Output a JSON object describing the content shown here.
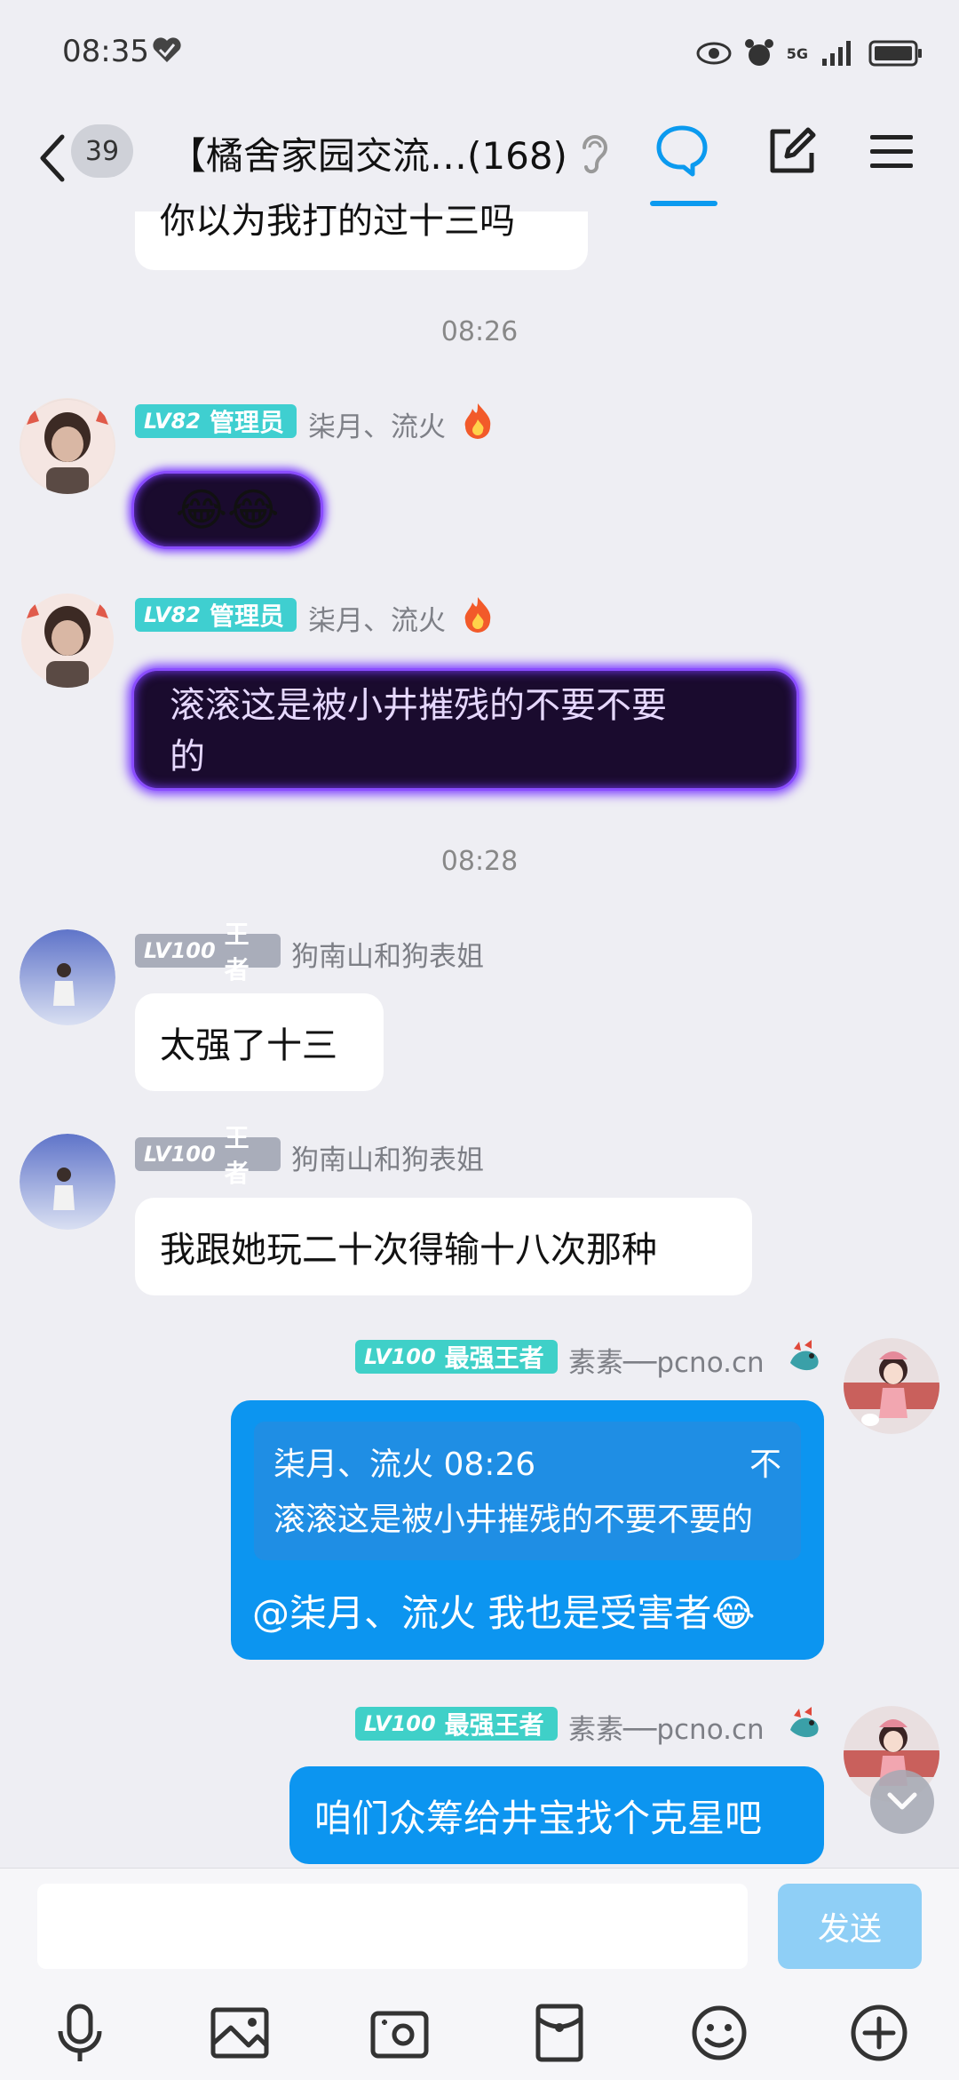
{
  "status_bar": {
    "time": "08:35",
    "network": "5G"
  },
  "header": {
    "back_count": "39",
    "title": "【橘舍家园交流…(168)"
  },
  "messages": {
    "partial_text": "你以为我打的过十三吗",
    "time1": "08:26",
    "msg1": {
      "level": "LV82",
      "role": "管理员",
      "nick": "柒月、流火",
      "emoji": "😂😂"
    },
    "msg2": {
      "level": "LV82",
      "role": "管理员",
      "nick": "柒月、流火",
      "text_line1": "滚滚这是被小井摧残的不要不要",
      "text_line2": "的"
    },
    "time2": "08:28",
    "msg3": {
      "level": "LV100",
      "role": "王者",
      "nick": "狗南山和狗表姐",
      "text": "太强了十三"
    },
    "msg4": {
      "level": "LV100",
      "role": "王者",
      "nick": "狗南山和狗表姐",
      "text": "我跟她玩二十次得输十八次那种"
    },
    "msg5": {
      "level": "LV100",
      "role": "最强王者",
      "nick": "素素──pcno.cn",
      "quote_header": "柒月、流火 08:26",
      "quote_suffix": "不",
      "quote_text": "滚滚这是被小井摧残的不要不要的",
      "text": "@柒月、流火 我也是受害者😂"
    },
    "msg6": {
      "level": "LV100",
      "role": "最强王者",
      "nick": "素素──pcno.cn",
      "text": "咱们众筹给井宝找个克星吧"
    }
  },
  "input": {
    "placeholder": "",
    "send_label": "发送"
  },
  "colors": {
    "accent": "#0b9aef",
    "outgoing_bubble": "#0c95f0",
    "admin_tag": "#3fcfd0",
    "lv100_tag": "#a9adba",
    "king_tag": "#3fd0c8"
  }
}
